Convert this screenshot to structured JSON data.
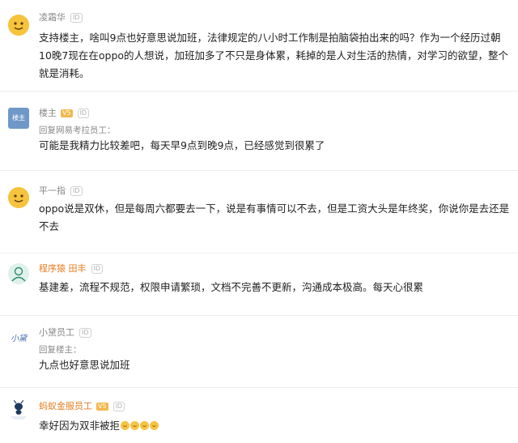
{
  "comments": [
    {
      "username": "凌霜华",
      "id_badge": "ID",
      "text": "支持楼主，啥叫9点也好意思说加班，法律规定的八小时工作制是拍脑袋拍出来的吗？作为一个经历过朝10晚7现在在oppo的人想说，加班加多了不只是身体累，耗掉的是人对生活的热情，对学习的欲望，整个就是消耗。"
    },
    {
      "username": "楼主",
      "avatar_text": "楼主",
      "vip_badge": "V5",
      "id_badge": "ID",
      "reply_to": "回复网易考拉员工：",
      "text": "可能是我精力比较差吧，每天早9点到晚9点，已经感觉到很累了"
    },
    {
      "username": "平一指",
      "id_badge": "ID",
      "text": "oppo说是双休，但是每周六都要去一下，说是有事情可以不去，但是工资大头是年终奖，你说你是去还是不去"
    },
    {
      "username": "程序猿 田丰",
      "id_badge": "ID",
      "text": "基建差，流程不规范，权限申请繁琐，文档不完善不更新，沟通成本极高。每天心很累"
    },
    {
      "username": "小黛员工",
      "avatar_text": "小黛",
      "id_badge": "ID",
      "reply_to": "回复楼主：",
      "text": "九点也好意思说加班"
    },
    {
      "username": "蚂蚁金服员工",
      "avatar_text": "蚂蚁金服",
      "vip_badge": "V5",
      "id_badge": "ID",
      "text": "幸好因为双非被拒"
    }
  ],
  "colors": {
    "username_gray": "#888888",
    "username_orange": "#e67e22",
    "text": "#222222",
    "divider": "#ececec"
  }
}
